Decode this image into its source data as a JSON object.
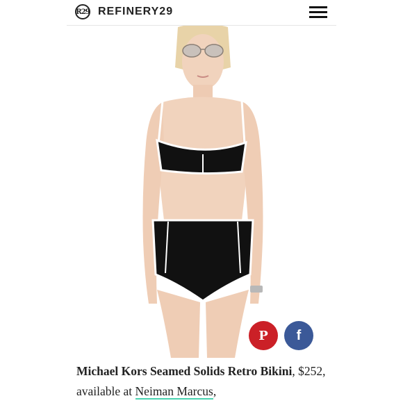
{
  "header": {
    "logo_mark": "R29",
    "logo_text": "REFINERY29"
  },
  "product": {
    "name": "Michael Kors Seamed Solids Retro Bikini",
    "price": ", $252, available at ",
    "retailer": "Neiman Marcus",
    "trailing": ","
  },
  "share": {
    "pinterest_label": "P",
    "facebook_label": "f"
  },
  "colors": {
    "pinterest": "#cb2027",
    "facebook": "#3b5998",
    "link_underline": "#49d3b0"
  }
}
